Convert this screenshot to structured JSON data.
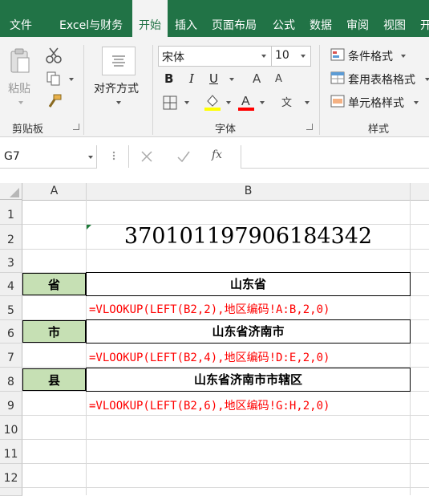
{
  "ribbon_tabs": [
    "文件",
    "Excel与财务",
    "开始",
    "插入",
    "页面布局",
    "公式",
    "数据",
    "审阅",
    "视图",
    "开"
  ],
  "clipboard": {
    "paste_label": "粘贴",
    "group_label": "剪贴板"
  },
  "alignment": {
    "label": "对齐方式"
  },
  "font": {
    "name": "宋体",
    "size": "10",
    "group_label": "字体",
    "bold": "B",
    "italic": "I",
    "underline": "U",
    "grow": "A",
    "shrink": "A",
    "phonetic": "文"
  },
  "styles": {
    "conditional_format": "条件格式",
    "table_format": "套用表格格式",
    "cell_styles": "单元格样式",
    "group_label": "样式"
  },
  "formula_bar": {
    "name_box": "G7",
    "fx": "fx",
    "content": ""
  },
  "columns": [
    "A",
    "B"
  ],
  "rows": [
    "1",
    "2",
    "3",
    "4",
    "5",
    "6",
    "7",
    "8",
    "9",
    "10",
    "11",
    "12"
  ],
  "cells": {
    "B2": "370101197906184342",
    "A4": "省",
    "B4": "山东省",
    "B5": "=VLOOKUP(LEFT(B2,2),地区编码!A:B,2,0)",
    "A6": "市",
    "B6": "山东省济南市",
    "B7": "=VLOOKUP(LEFT(B2,4),地区编码!D:E,2,0)",
    "A8": "县",
    "B8": "山东省济南市市辖区",
    "B9": "=VLOOKUP(LEFT(B2,6),地区编码!G:H,2,0)"
  },
  "colors": {
    "excel_green": "#217346",
    "label_fill": "#c6e0b4",
    "formula_red": "#ff0000"
  }
}
